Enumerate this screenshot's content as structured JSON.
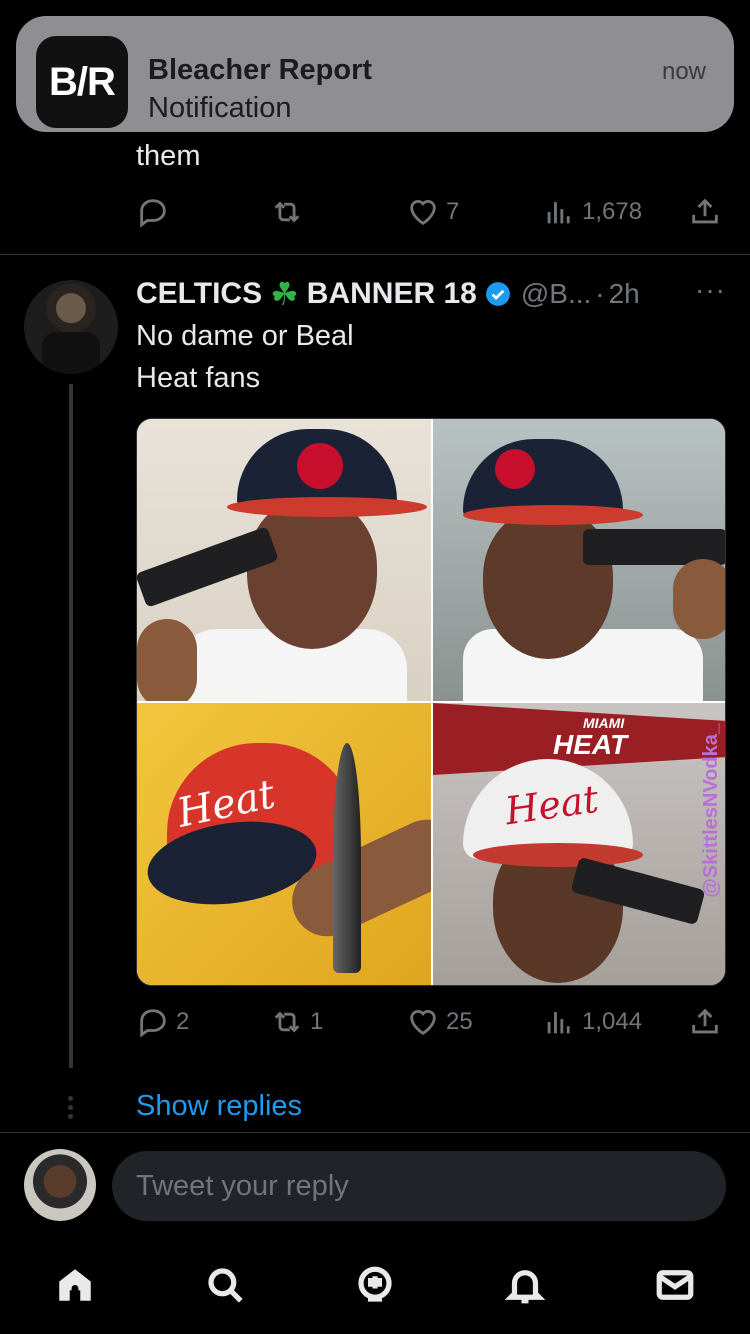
{
  "notification": {
    "app": "Bleacher Report",
    "body": "Notification",
    "time": "now",
    "logo_text": "B/R"
  },
  "previous_tweet": {
    "text_tail": "them",
    "replies": "",
    "retweets": "",
    "likes": "7",
    "views": "1,678"
  },
  "tweet": {
    "display_name": "CELTICS",
    "name_emoji": "☘️",
    "display_name_suffix": "BANNER 18",
    "handle": "@B...",
    "separator": "·",
    "time": "2h",
    "more": "···",
    "line1": "No dame or Beal",
    "line2": "Heat fans",
    "media": {
      "pennant_small": "MIAMI",
      "pennant_large": "HEAT",
      "cap_text_1": "Heat",
      "cap_text_2": "Heat",
      "watermark": "@SkittlesNVodka_"
    },
    "replies": "2",
    "retweets": "1",
    "likes": "25",
    "views": "1,044"
  },
  "show_replies": "Show replies",
  "reply": {
    "placeholder": "Tweet your reply"
  },
  "colors": {
    "background": "#000000",
    "accent": "#1d9bf0",
    "muted": "#71767b",
    "verified": "#1d9bf0"
  },
  "tabs": [
    "home-icon",
    "search-icon",
    "spaces-icon",
    "notifications-icon",
    "messages-icon"
  ]
}
